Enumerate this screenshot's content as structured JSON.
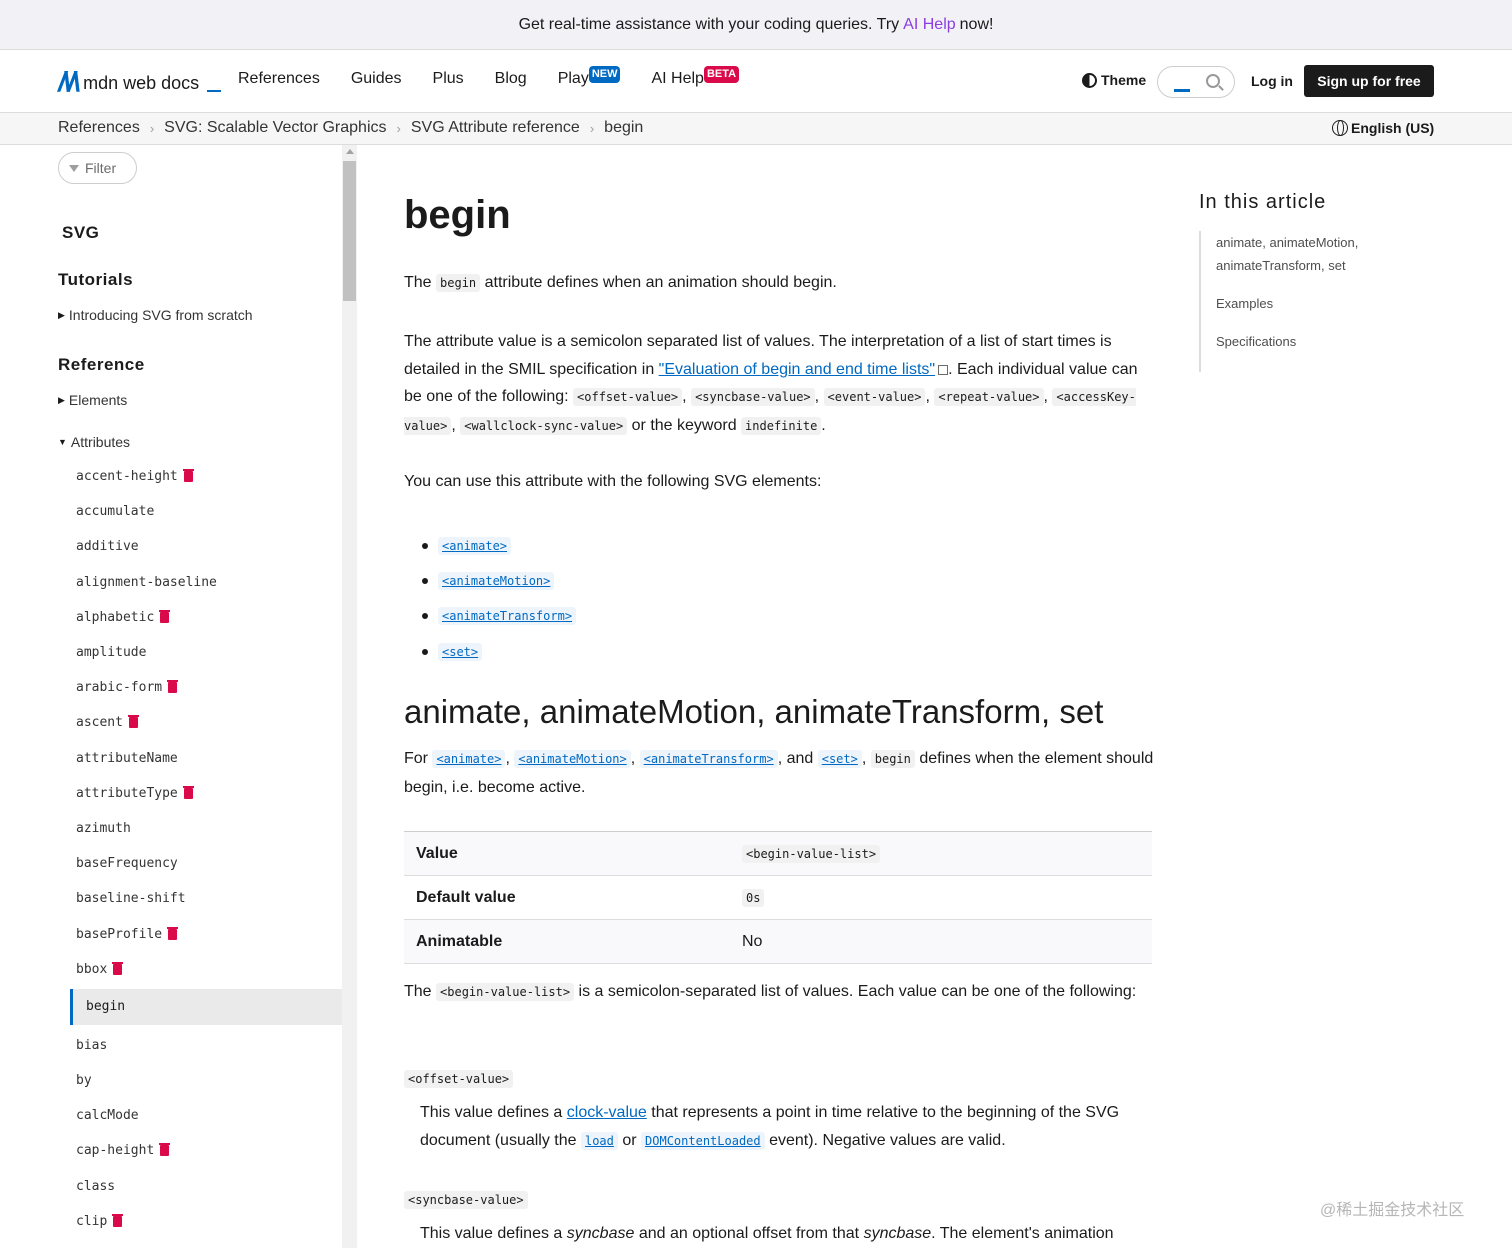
{
  "banner": {
    "text_before": "Get real-time assistance with your coding queries. Try",
    "ai_link": "AI Help",
    "text_after": "now!"
  },
  "header": {
    "logo_text": "mdn web docs",
    "nav": [
      {
        "label": "References",
        "tag": ""
      },
      {
        "label": "Guides",
        "tag": ""
      },
      {
        "label": "Plus",
        "tag": ""
      },
      {
        "label": "Blog",
        "tag": ""
      },
      {
        "label": "Play",
        "tag": "NEW"
      },
      {
        "label": "AI Help",
        "tag": "BETA"
      }
    ],
    "theme_label": "Theme",
    "login_label": "Log in",
    "signup_label": "Sign up for free"
  },
  "breadcrumbs": [
    "References",
    "SVG: Scalable Vector Graphics",
    "SVG Attribute reference",
    "begin"
  ],
  "language": "English (US)",
  "sidebar": {
    "filter_placeholder": "Filter",
    "heading_svg": "SVG",
    "heading_tutorials": "Tutorials",
    "tutorial_link": "Introducing SVG from scratch",
    "heading_reference": "Reference",
    "elements_link": "Elements",
    "attributes_link": "Attributes",
    "attributes": [
      {
        "name": "accent-height",
        "deprecated": true
      },
      {
        "name": "accumulate",
        "deprecated": false
      },
      {
        "name": "additive",
        "deprecated": false
      },
      {
        "name": "alignment-baseline",
        "deprecated": false
      },
      {
        "name": "alphabetic",
        "deprecated": true
      },
      {
        "name": "amplitude",
        "deprecated": false
      },
      {
        "name": "arabic-form",
        "deprecated": true
      },
      {
        "name": "ascent",
        "deprecated": true
      },
      {
        "name": "attributeName",
        "deprecated": false
      },
      {
        "name": "attributeType",
        "deprecated": true
      },
      {
        "name": "azimuth",
        "deprecated": false
      },
      {
        "name": "baseFrequency",
        "deprecated": false
      },
      {
        "name": "baseline-shift",
        "deprecated": false
      },
      {
        "name": "baseProfile",
        "deprecated": true
      },
      {
        "name": "bbox",
        "deprecated": true
      },
      {
        "name": "begin",
        "deprecated": false,
        "active": true
      },
      {
        "name": "bias",
        "deprecated": false
      },
      {
        "name": "by",
        "deprecated": false
      },
      {
        "name": "calcMode",
        "deprecated": false
      },
      {
        "name": "cap-height",
        "deprecated": true
      },
      {
        "name": "class",
        "deprecated": false
      },
      {
        "name": "clip",
        "deprecated": true
      }
    ]
  },
  "article": {
    "title": "begin",
    "intro_the": "The",
    "intro_code": "begin",
    "intro_rest": "attribute defines when an animation should begin.",
    "p2_a": "The attribute value is a semicolon separated list of values. The interpretation of a list of start times is detailed in the SMIL specification in",
    "p2_link": "\"Evaluation of begin and end time lists\"",
    "p2_b": ". Each individual value can be one of the following:",
    "p2_codes": [
      "<offset-value>",
      "<syncbase-value>",
      "<event-value>",
      "<repeat-value>",
      "<accessKey-value>",
      "<wallclock-sync-value>"
    ],
    "p2_c": "or the keyword",
    "p2_keyword": "indefinite",
    "p3": "You can use this attribute with the following SVG elements:",
    "elements": [
      "<animate>",
      "<animateMotion>",
      "<animateTransform>",
      "<set>"
    ],
    "h2": "animate, animateMotion, animateTransform, set",
    "p4_for": "For",
    "p4_and": ", and",
    "p4_code": "begin",
    "p4_rest": "defines when the element should begin, i.e. become active.",
    "table": [
      {
        "key": "Value",
        "value": "<begin-value-list>",
        "is_code": true
      },
      {
        "key": "Default value",
        "value": "0s",
        "is_code": true
      },
      {
        "key": "Animatable",
        "value": "No",
        "is_code": false
      }
    ],
    "p5_the": "The",
    "p5_code": "<begin-value-list>",
    "p5_rest": "is a semicolon-separated list of values. Each value can be one of the following:",
    "dt1": "<offset-value>",
    "dd1_a": "This value defines a",
    "dd1_link": "clock-value",
    "dd1_b": "that represents a point in time relative to the beginning of the SVG document (usually the",
    "dd1_load": "load",
    "dd1_or": "or",
    "dd1_dcl": "DOMContentLoaded",
    "dd1_c": "event). Negative values are valid.",
    "dt2": "<syncbase-value>",
    "dd2_a": "This value defines a",
    "dd2_em1": "syncbase",
    "dd2_b": "and an optional offset from that",
    "dd2_em2": "syncbase",
    "dd2_c": ". The element's animation"
  },
  "toc": {
    "title": "In this article",
    "items": [
      "animate, animateMotion, animateTransform, set",
      "Examples",
      "Specifications"
    ]
  },
  "watermark": "@稀土掘金技术社区"
}
